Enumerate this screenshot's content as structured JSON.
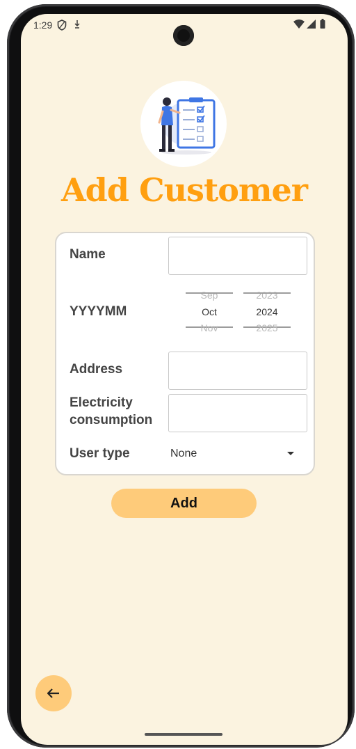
{
  "status_bar": {
    "time": "1:29",
    "left_icons": [
      "shield-icon",
      "download-icon"
    ],
    "right_icons": [
      "wifi-icon",
      "signal-icon",
      "battery-icon"
    ]
  },
  "page": {
    "title": "Add Customer",
    "hero_image": "clipboard-checklist-illustration"
  },
  "form": {
    "name": {
      "label": "Name",
      "value": ""
    },
    "yyyymm": {
      "label": "YYYYMM",
      "months": {
        "prev": "Sep",
        "selected": "Oct",
        "next": "Nov"
      },
      "years": {
        "prev": "2023",
        "selected": "2024",
        "next": "2025"
      }
    },
    "address": {
      "label": "Address",
      "value": ""
    },
    "electricity": {
      "label_line1": "Electricity",
      "label_line2": "consumption",
      "value": ""
    },
    "user_type": {
      "label": "User type",
      "selected": "None"
    }
  },
  "actions": {
    "add_label": "Add",
    "back_icon": "arrow-left-icon"
  },
  "colors": {
    "background": "#fbf3e0",
    "accent": "#ff9f10",
    "button": "#fecb7a"
  }
}
